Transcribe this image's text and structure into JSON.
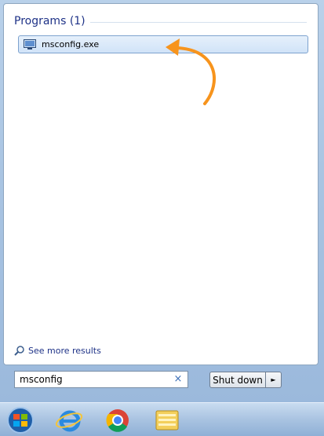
{
  "programs": {
    "title": "Programs (1)",
    "items": [
      {
        "label": "msconfig.exe",
        "icon": "system-config-icon"
      }
    ]
  },
  "see_more": {
    "label": "See more results"
  },
  "search": {
    "value": "msconfig",
    "clear_icon": "clear-icon",
    "clear_glyph": "×"
  },
  "shutdown": {
    "label": "Shut down",
    "arrow_icon": "arrow-right-icon",
    "arrow_glyph": "►"
  },
  "taskbar": {
    "items": [
      "start-orb-icon",
      "internet-explorer-icon",
      "chrome-icon",
      "file-explorer-icon"
    ]
  },
  "colors": {
    "accent_arrow": "#f7941d",
    "title_blue": "#1e3287",
    "highlight_border": "#7da2ce"
  }
}
